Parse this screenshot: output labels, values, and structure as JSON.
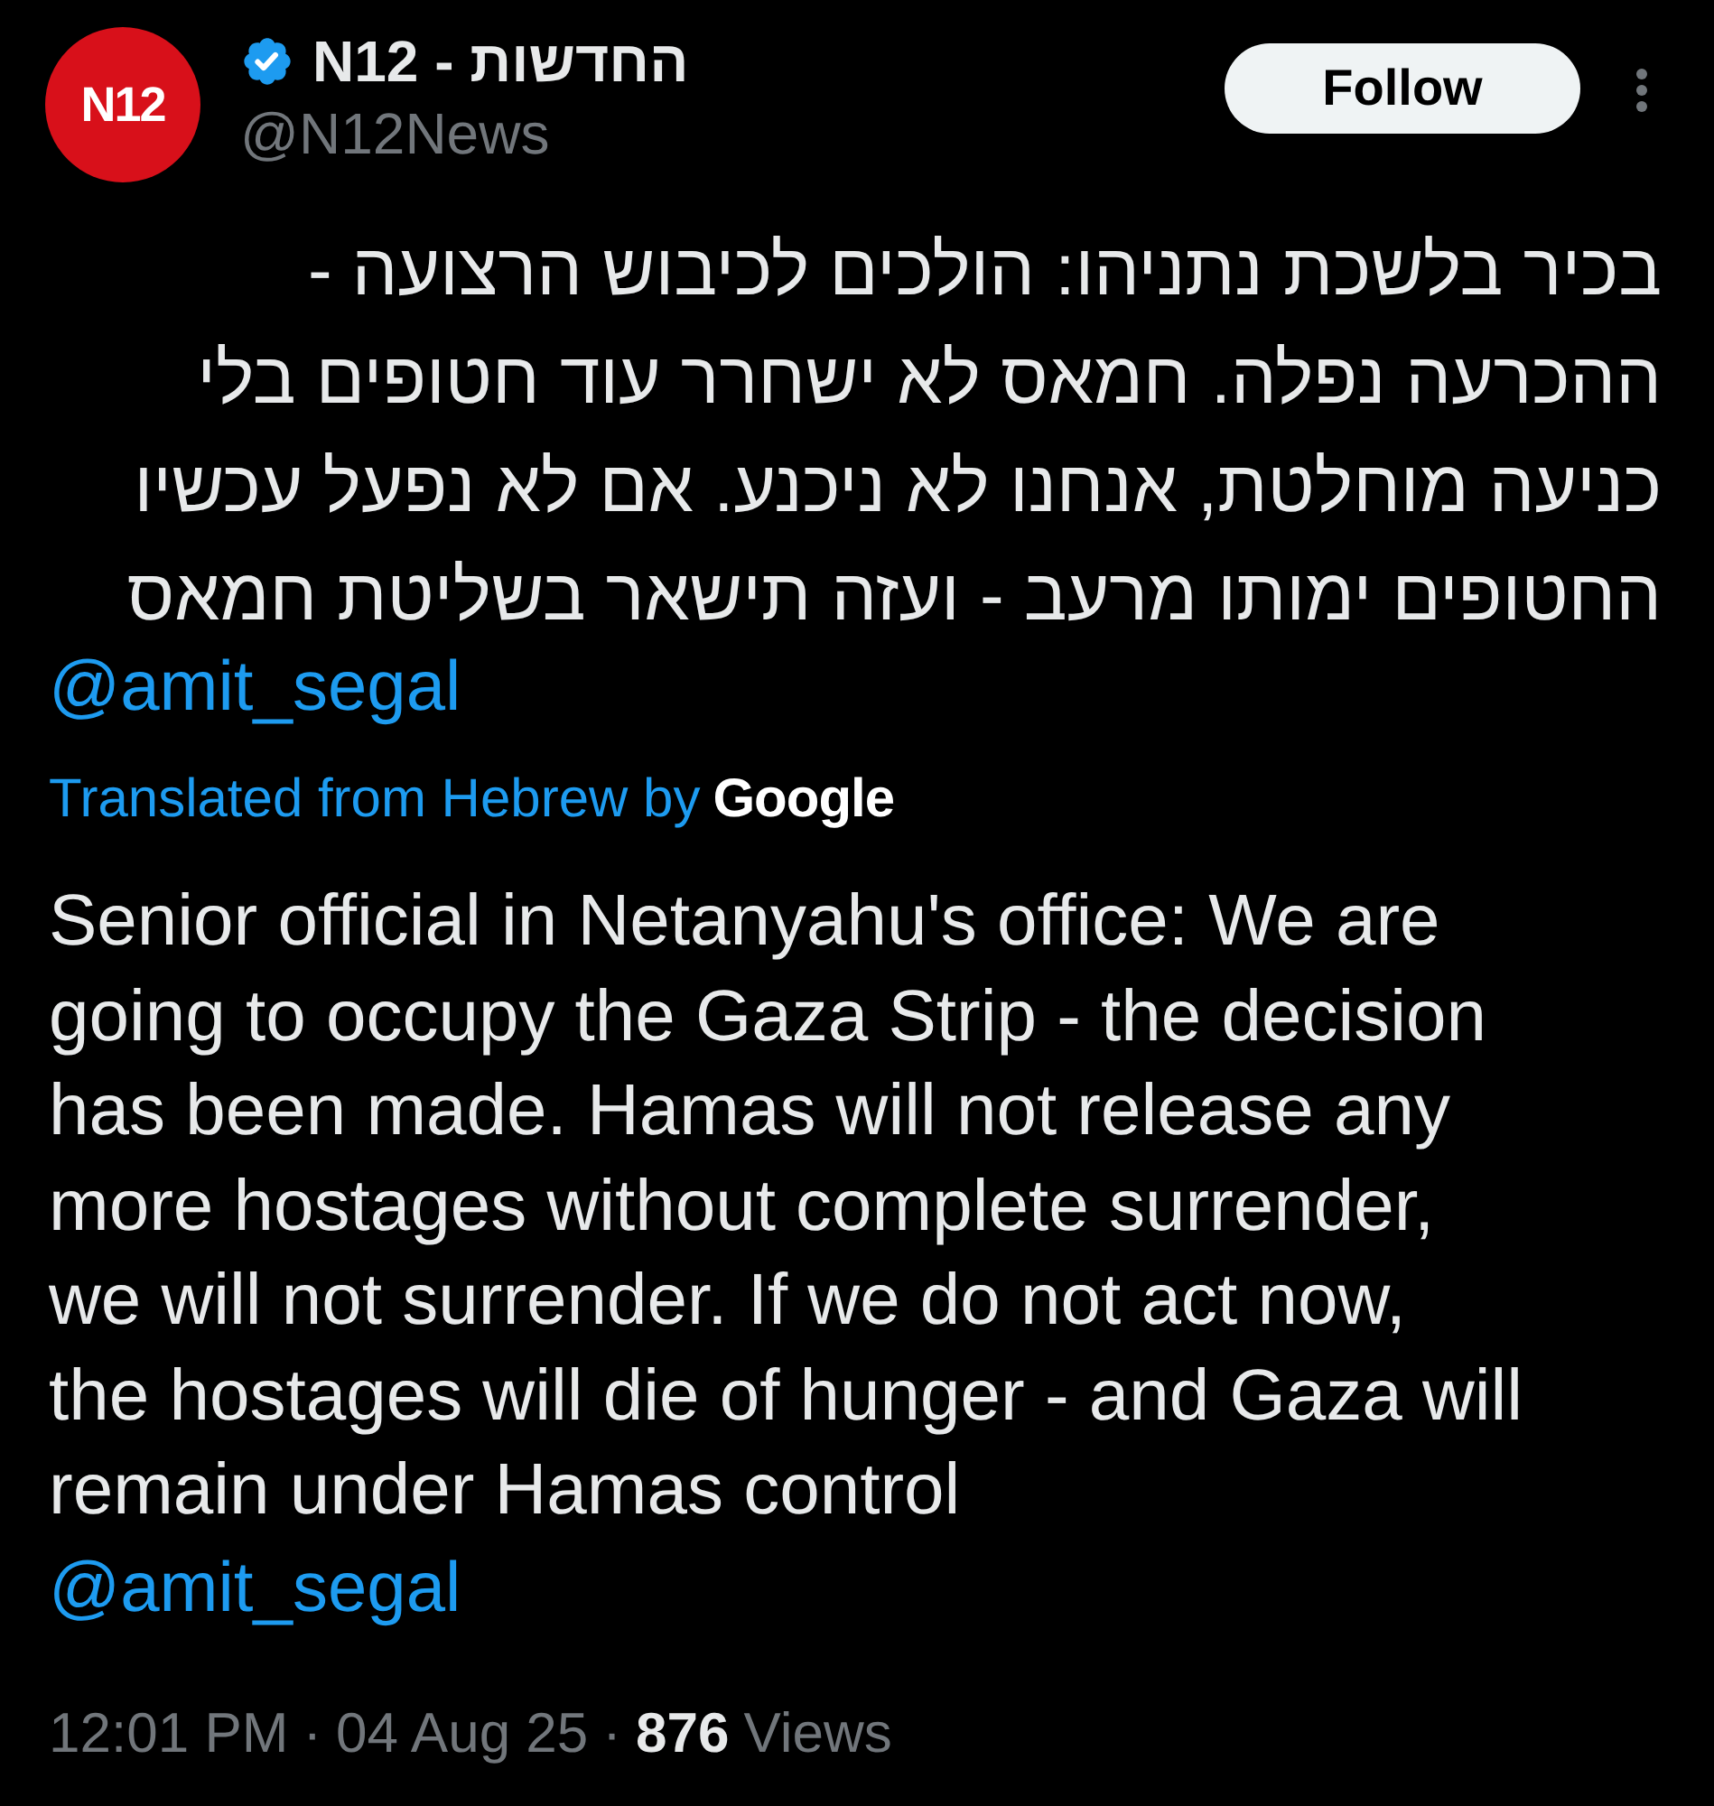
{
  "header": {
    "avatar_text": "N12",
    "name": "N12 - החדשות",
    "verified": true,
    "handle": "@N12News",
    "follow_button": "Follow"
  },
  "original_text": {
    "lines": [
      "בכיר בלשכת נתניהו: הולכים לכיבוש הרצועה -",
      "ההכרעה נפלה. חמאס לא ישחרר עוד חטופים בלי",
      "כניעה מוחלטת, אנחנו לא ניכנע. אם לא נפעל עכשיו",
      "החטופים ימותו מרעב - ועזה תישאר בשליטת חמאס"
    ],
    "mention": "@amit_segal"
  },
  "translation": {
    "label": "Translated from Hebrew by",
    "provider": "Google"
  },
  "translated_text": {
    "lines": [
      "Senior official in Netanyahu's office: We are",
      "going to occupy the Gaza Strip - the decision",
      "has been made. Hamas will not release any",
      "more hostages without complete surrender,",
      "we will not surrender. If we do not act now,",
      "the hostages will die of hunger - and Gaza will",
      "remain under Hamas control"
    ],
    "mention": "@amit_segal"
  },
  "meta": {
    "time": "12:01 PM",
    "separator_1": "·",
    "date": "04 Aug 25",
    "separator_2": "·",
    "views_count": "876",
    "views_label": "Views"
  }
}
